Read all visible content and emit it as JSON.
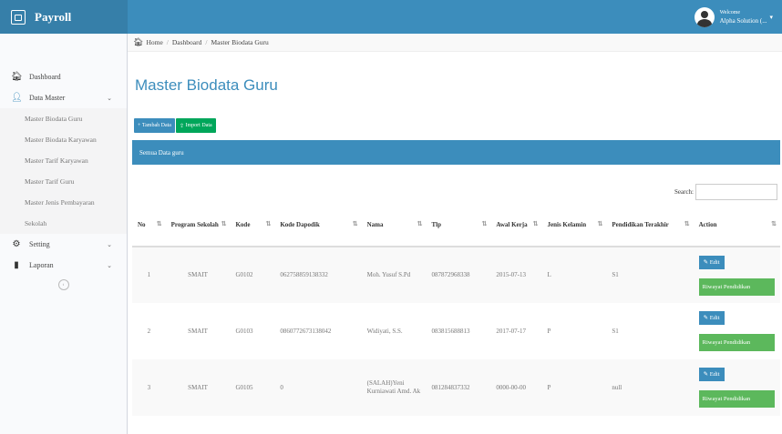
{
  "app": {
    "title": "Payroll"
  },
  "user": {
    "greeting": "Welcome",
    "name": "Alpha Solution (..."
  },
  "breadcrumb": [
    "Home",
    "Dashboard",
    "Master Biodata Guru"
  ],
  "sidebar": {
    "dashboard": "Dashboard",
    "data_master": "Data Master",
    "sub_items": [
      "Master Biodata Guru",
      "Master Biodata Karyawan",
      "Master Tarif Karyawan",
      "Master Tarif Guru",
      "Master Jenis Pembayaran",
      "Sekolah"
    ],
    "setting": "Setting",
    "laporan": "Laporan"
  },
  "page": {
    "title": "Master Biodata Guru",
    "btn_tambah": "Tambah Data",
    "btn_import": "Import Data",
    "box_title": "Semua Data guru",
    "search_label": "Search:"
  },
  "table": {
    "headers": [
      "No",
      "Program Sekolah",
      "Kode",
      "Kode Dapodik",
      "Nama",
      "Tlp",
      "Awal Kerja",
      "Jenis Kelamin",
      "Pendidikan Terakhir",
      "Action"
    ],
    "rows": [
      [
        "1",
        "SMAIT",
        "G0102",
        "062758859138332",
        "Moh. Yusuf S.Pd",
        "087872968338",
        "2015-07-13",
        "L",
        "S1"
      ],
      [
        "2",
        "SMAIT",
        "G0103",
        "0860772673138042",
        "Widiyati, S.S.",
        "083815688813",
        "2017-07-17",
        "P",
        "S1"
      ],
      [
        "3",
        "SMAIT",
        "G0105",
        "0",
        "(SALAH)Yeni Kurniawati Amd. Ak",
        "081284837332",
        "0000-00-00",
        "P",
        "null"
      ]
    ],
    "edit_label": "Edit",
    "riwayat_label": "Riwayat Pendidikan"
  },
  "colors": {
    "primary": "#3c8dbc",
    "success": "#00a65a",
    "riwayat": "#5cb85c"
  }
}
